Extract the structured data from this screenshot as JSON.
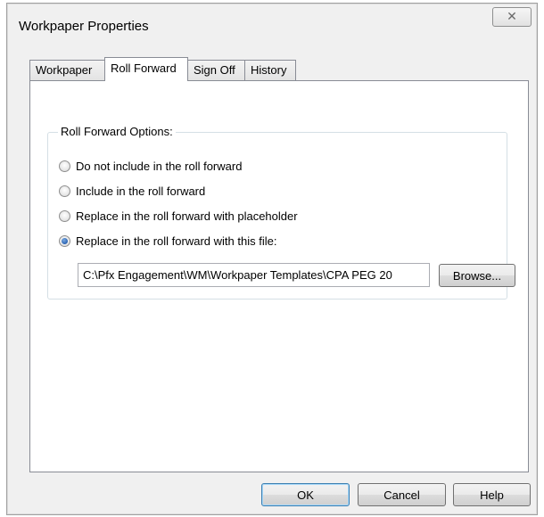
{
  "window": {
    "title": "Workpaper Properties",
    "close_glyph": "✕"
  },
  "tabs": [
    {
      "label": "Workpaper",
      "active": false
    },
    {
      "label": "Roll Forward",
      "active": true
    },
    {
      "label": "Sign Off",
      "active": false
    },
    {
      "label": "History",
      "active": false
    }
  ],
  "roll_forward": {
    "group_label": "Roll Forward Options:",
    "options": [
      {
        "label": "Do not include in the roll forward",
        "checked": false
      },
      {
        "label": "Include in the roll forward",
        "checked": false
      },
      {
        "label": "Replace in the roll forward with placeholder",
        "checked": false
      },
      {
        "label": "Replace in the roll forward with this file:",
        "checked": true
      }
    ],
    "file_path": "C:\\Pfx Engagement\\WM\\Workpaper Templates\\CPA PEG 20",
    "browse_label": "Browse..."
  },
  "footer": {
    "ok_label": "OK",
    "cancel_label": "Cancel",
    "help_label": "Help"
  },
  "colors": {
    "dialog_bg": "#f0f0f0",
    "panel_bg": "#ffffff",
    "radio_checked": "#2a63b3"
  }
}
